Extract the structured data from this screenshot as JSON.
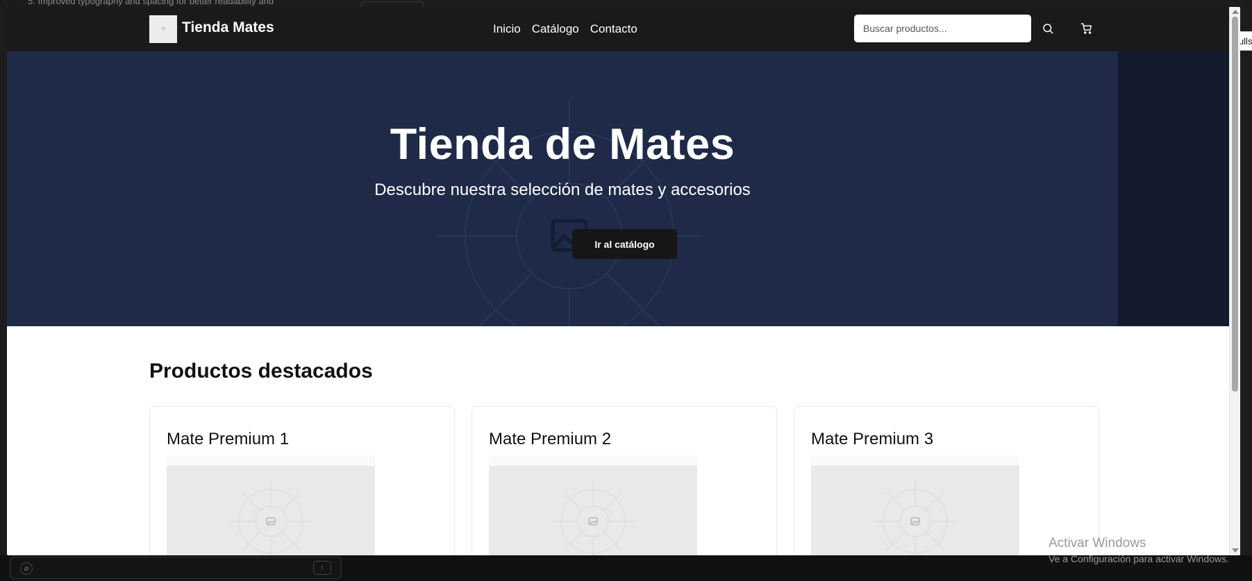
{
  "background": {
    "editor_line": "5.  Improved typography and spacing for better readability and"
  },
  "tooltip": {
    "label": "Fullscreen"
  },
  "header": {
    "brand": "Tienda Mates",
    "nav": [
      "Inicio",
      "Catálogo",
      "Contacto"
    ],
    "search_placeholder": "Buscar productos...",
    "search_icon": "search-icon",
    "cart_icon": "cart-icon"
  },
  "hero": {
    "title": "Tienda de Mates",
    "subtitle": "Descubre nuestra selección de mates y accesorios",
    "cta": "Ir al catálogo",
    "bg_color": "#1e2a47"
  },
  "featured": {
    "title": "Productos destacados",
    "products": [
      {
        "name": "Mate Premium 1"
      },
      {
        "name": "Mate Premium 2"
      },
      {
        "name": "Mate Premium 3"
      }
    ]
  },
  "watermark": {
    "title": "Activar Windows",
    "subtitle": "Ve a Configuración para activar Windows."
  },
  "colors": {
    "navbar": "#1a1a1a",
    "hero": "#1e2a47",
    "button": "#161616"
  }
}
